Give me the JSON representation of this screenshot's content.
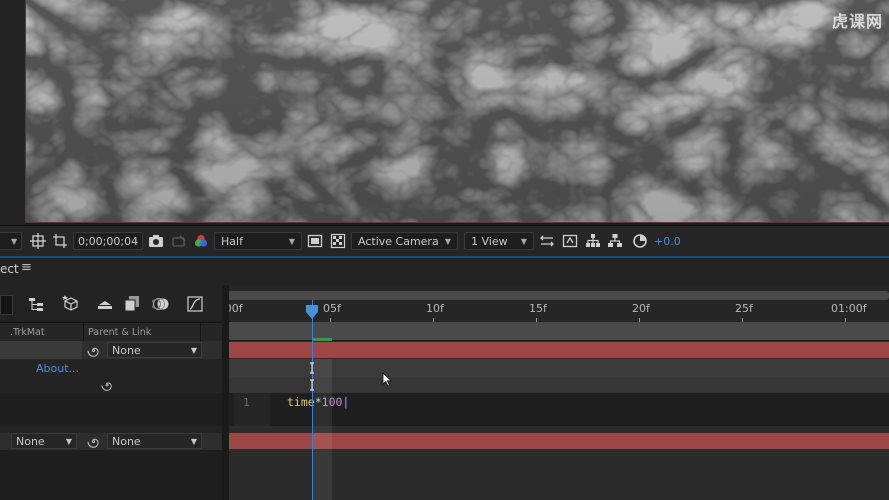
{
  "watermark": "虎课网",
  "viewer_toolbar": {
    "timecode": "0;00;00;04",
    "resolution": "Half",
    "camera": "Active Camera",
    "view": "1 View",
    "exposure": "+0.0"
  },
  "timeline": {
    "tab_name": "ect",
    "tab_menu": "≡",
    "columns": {
      "trkmat": ".TrkMat",
      "parent_link": "Parent & Link"
    },
    "ruler_labels": [
      ":00f",
      "05f",
      "10f",
      "15f",
      "20f",
      "25f",
      "01:00f"
    ],
    "layer1": {
      "parent": "None"
    },
    "effect_link": "About...",
    "expression": {
      "line_number": "1",
      "code_keyword": "time",
      "code_op": "*",
      "code_num": "100"
    },
    "layer2": {
      "trkmat": "None",
      "parent": "None"
    }
  },
  "colors": {
    "layer_bar": "#9e4545",
    "playhead": "#3f7fcf",
    "accent_blue": "#4c8fd9",
    "work_area_green": "#2ea043"
  }
}
